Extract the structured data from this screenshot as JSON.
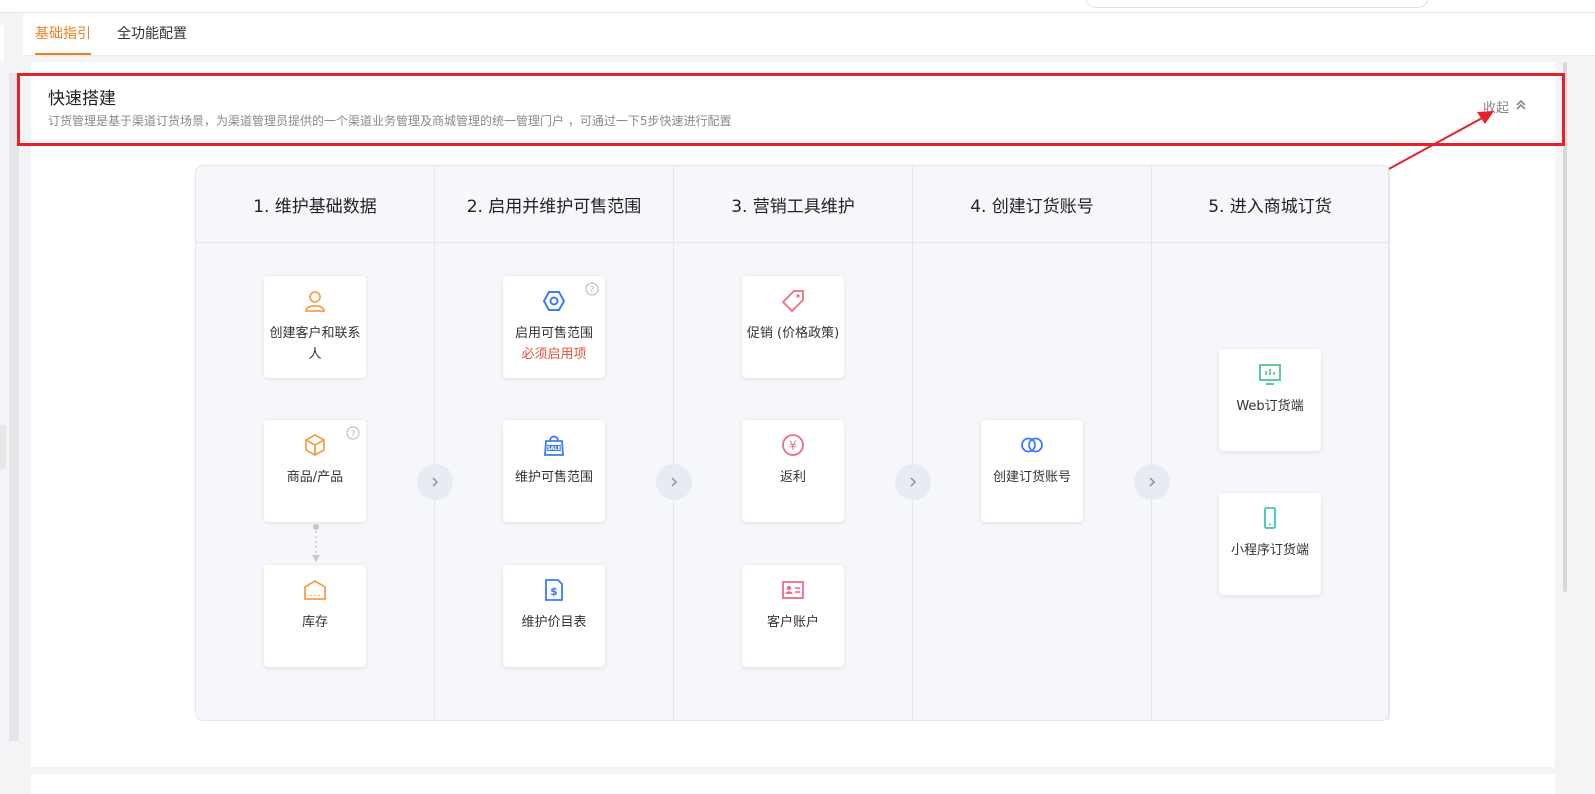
{
  "tabs": [
    {
      "label": "基础指引",
      "active": true
    },
    {
      "label": "全功能配置",
      "active": false
    }
  ],
  "quick_setup": {
    "title": "快速搭建",
    "description": "订货管理是基于渠道订货场景，为渠道管理员提供的一个渠道业务管理及商城管理的统一管理门户 ，可通过一下5步快速进行配置",
    "collapse_label": "收起"
  },
  "steps": [
    {
      "title": "1. 维护基础数据",
      "cards": [
        {
          "label": "创建客户和联系人",
          "icon": "user-icon",
          "color": "#f5a048"
        },
        {
          "label": "商品/产品",
          "icon": "box-icon",
          "color": "#f5a048"
        },
        {
          "label": "库存",
          "icon": "warehouse-icon",
          "color": "#f5a048"
        }
      ]
    },
    {
      "title": "2. 启用并维护可售范围",
      "cards": [
        {
          "label": "启用可售范围",
          "required": "必须启用项",
          "icon": "hexagon-icon",
          "color": "#3b7cf5"
        },
        {
          "label": "维护可售范围",
          "icon": "sale-bag-icon",
          "color": "#3b7cf5"
        },
        {
          "label": "维护价目表",
          "icon": "price-list-icon",
          "color": "#3b7cf5"
        }
      ]
    },
    {
      "title": "3. 营销工具维护",
      "cards": [
        {
          "label": "促销 (价格政策)",
          "icon": "tag-icon",
          "color": "#ee6c84"
        },
        {
          "label": "返利",
          "icon": "yen-icon",
          "color": "#ee6c84"
        },
        {
          "label": "客户账户",
          "icon": "id-card-icon",
          "color": "#ee6c84"
        }
      ]
    },
    {
      "title": "4. 创建订货账号",
      "cards": [
        {
          "label": "创建订货账号",
          "icon": "rings-icon",
          "color": "#3b7cf5"
        }
      ]
    },
    {
      "title": "5. 进入商城订货",
      "cards": [
        {
          "label": "Web订货端",
          "icon": "monitor-icon",
          "color": "#4cc68c"
        },
        {
          "label": "小程序订货端",
          "icon": "phone-icon",
          "color": "#3ec3c3"
        }
      ]
    }
  ],
  "colors": {
    "accent": "#f47f1f",
    "highlight": "#e6212a"
  }
}
